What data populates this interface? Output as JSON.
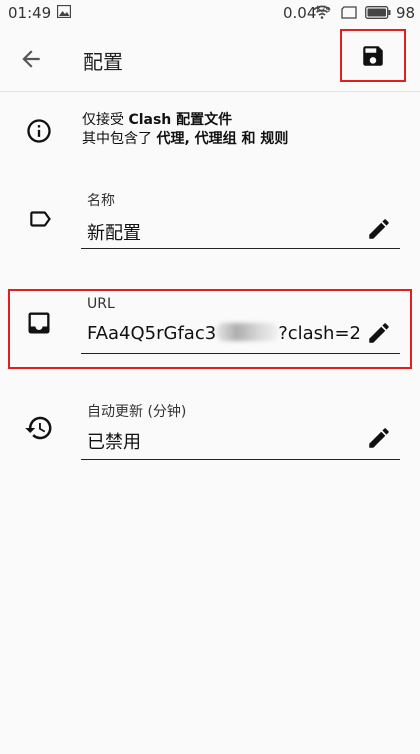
{
  "status_bar": {
    "time": "01:49",
    "net_speed": "0.04",
    "net_speed_unit": "K/s",
    "battery": "98"
  },
  "toolbar": {
    "title": "配置",
    "back_icon": "arrow-back-icon",
    "save_icon": "floppy-disk-icon"
  },
  "info": {
    "icon": "info-circle-icon",
    "line1_prefix": "仅接受 ",
    "line1_bold": "Clash 配置文件",
    "line2_prefix": "其中包含了 ",
    "line2_bold": "代理, 代理组 和 规则"
  },
  "fields": {
    "name": {
      "icon": "label-tag-icon",
      "label": "名称",
      "value": "新配置"
    },
    "url": {
      "icon": "inbox-icon",
      "label": "URL",
      "value_start": "FAa4Q5rGfac3",
      "value_end": "?clash=2"
    },
    "auto_update": {
      "icon": "history-clock-icon",
      "label": "自动更新 (分钟)",
      "value": "已禁用"
    }
  },
  "colors": {
    "highlight": "#e0201e",
    "background": "#fafafa",
    "text": "#111111"
  }
}
